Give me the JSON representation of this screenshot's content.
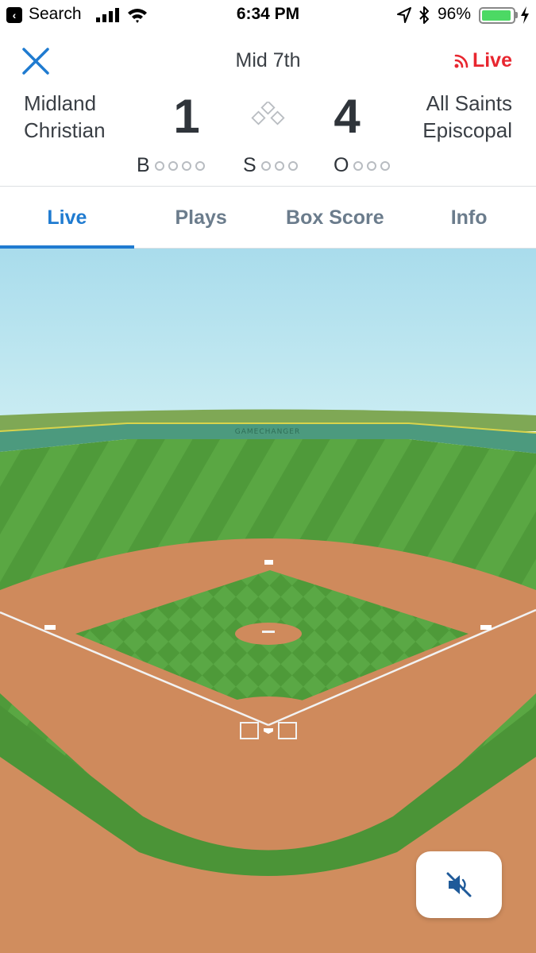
{
  "status_bar": {
    "back_app": "Search",
    "time": "6:34 PM",
    "battery_percent": "96%",
    "battery_level": 0.96,
    "icons": [
      "back-arrow-icon",
      "cellular-signal-icon",
      "wifi-icon",
      "location-arrow-icon",
      "bluetooth-icon",
      "battery-icon",
      "charging-bolt-icon"
    ]
  },
  "header": {
    "close_icon": "close-x-icon",
    "inning": "Mid 7th",
    "live_label": "Live",
    "live_icon": "broadcast-icon"
  },
  "scoreboard": {
    "away_team_line1": "Midland",
    "away_team_line2": "Christian",
    "away_score": "1",
    "home_team_line1": "All Saints",
    "home_team_line2": "Episcopal",
    "home_score": "4",
    "bases_icon": "bases-diamond-icon",
    "count": {
      "balls_label": "B",
      "balls": 0,
      "balls_max": 4,
      "strikes_label": "S",
      "strikes": 0,
      "strikes_max": 3,
      "outs_label": "O",
      "outs": 0,
      "outs_max": 3
    }
  },
  "tabs": [
    {
      "label": "Live",
      "active": true
    },
    {
      "label": "Plays",
      "active": false
    },
    {
      "label": "Box Score",
      "active": false
    },
    {
      "label": "Info",
      "active": false
    }
  ],
  "field": {
    "wall_text": "GAMECHANGER"
  },
  "mute_button": {
    "icon": "speaker-muted-icon"
  },
  "colors": {
    "accent_blue": "#1f7bd0",
    "live_red": "#e8262f",
    "grass": "#4f9a3a",
    "dirt": "#cf8a5c",
    "sky": "#bfe6f0"
  }
}
